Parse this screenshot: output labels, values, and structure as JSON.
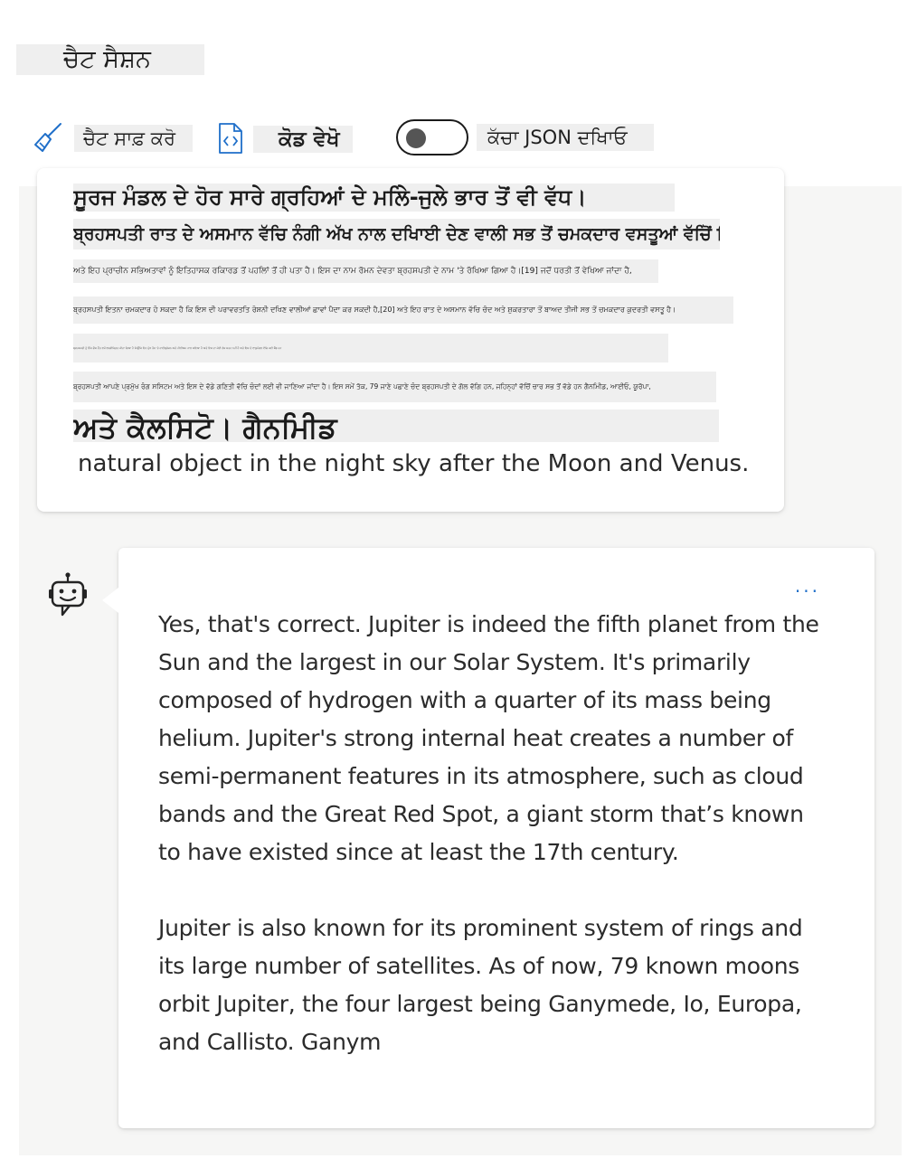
{
  "session": {
    "title": "ਚੈਟ ਸੈਸ਼ਨ"
  },
  "toolbar": {
    "clear_label": "ਚੈਟ ਸਾਫ਼ ਕਰੋ",
    "code_label": "ਕੋਡ ਵੇਖੋ",
    "json_label": "ਕੱਚਾ JSON ਦਖਿਾਓ",
    "json_toggle_on": false
  },
  "user_message": {
    "lines": [
      "ਸੂਰਜ ਮੰਡਲ ਦੇ ਹੋਰ ਸਾਰੇ ਗ੍ਰਹਿਆਂ ਦੇ ਮਲਿੇ-ਜੁਲੇ ਭਾਰ ਤੋਂ ਵੀ ਵੱਧ।",
      "ਬ੍ਰਹਸਪਤੀ ਰਾਤ ਦੇ ਅਸਮਾਨ ਵੱਚਿ ਨੰਗੀ ਅੱਖ ਨਾਲ ਦਖਿਾਈ ਦੇਣ ਵਾਲੀ ਸਭ ਤੋਂ ਚਮਕਦਾਰ ਵਸਤੂਆਂ ਵੱਚਿੋਂ ਇੱਕ ਹੈ,",
      "ਅਤੇ ਇਹ ਪ੍ਰਾਚੀਨ ਸਭਿਅਤਾਵਾਂ ਨੂੰ ਇਤਿਹਾਸਕ ਰਕਿਾਰਡ ਤੋਂ ਪਹਲਿਾਂ ਤੋਂ ਹੀ ਪਤਾ ਹੈ। ਇਸ ਦਾ ਨਾਮ ਰੋਮਨ ਦੇਵਤਾ ਬ੍ਰਹਸਪਤੀ ਦੇ ਨਾਮ 'ਤੇ ਰੱਖਿਆ ਗਿਆ ਹੈ।[19] ਜਦੋਂ ਧਰਤੀ ਤੋਂ ਵੇਖਿਆ ਜਾਂਦਾ ਹੈ,",
      "ਬ੍ਰਹਸਪਤੀ ਇਤਨਾ ਚਮਕਦਾਰ ਹੋ ਸਕਦਾ ਹੈ ਕਿ ਇਸ ਦੀ ਪਰਾਵਰਤਤਿ ਰੋਸ਼ਨੀ ਦਖਿਣ ਵਾਲੀਆਂ ਛਾਵਾਂ ਪੈਦਾ ਕਰ ਸਕਦੀ ਹੈ,[20] ਅਤੇ ਇਹ ਰਾਤ ਦੇ ਅਸਮਾਨ ਵੱਚਿ ਚੰਦ ਅਤੇ ਸ਼ੁਕਰਤਾਰਾ ਤੋਂ ਬਾਅਦ ਤੀਜੀ ਸਭ ਤੋਂ ਚਮਕਦਾਰ ਕੁਦਰਤੀ ਵਸਤੂ ਹੈ।",
      "ਬ੍ਰਹਸਪਤੀ ਨੂੰ ਇੱਕ ਗੈਸ ਦੈਂਤ ਵਜੋਂ ਵਰਗੀਕ੍ਰਿਤ ਕੀਤਾ ਗਿਆ ਹੈ ਕਿਉਂਕਿ ਇਹ ਮੁੱਖ ਤੌਰ 'ਤੇ ਹਾਈਡ੍ਰੋਜਨ ਅਤੇ ਹੀਲੀਅਮ ਨਾਲ ਬਣਿਆ ਹੈ ਅਤੇ ਇਸ ਦਾ ਕੋਈ ਠੋਸ ਸਤਹ ਨਹੀਂ ਹੈ ਅਤੇ ਇਸ ਦੇ ਵਾਯੂਮੰਡਲ ਵੱਚਿ ਕਈ ਬੈਂਡ ਹਨ",
      "ਬ੍ਰਹਸਪਤੀ ਆਪਣੇ ਪ੍ਰਮੁੱਖ ਰੰਗ ਸਸਿਟਮ ਅਤੇ ਇਸ ਦੇ ਵੱਡੇ ਗਣਿਤੀ ਵੱਚਿ ਚੰਦਾਂ ਲਈ ਵੀ ਜਾਣਿਆ ਜਾਂਦਾ ਹੈ। ਇਸ ਸਮੇਂ ਤੱਕ, 79 ਜਾਣੇ ਪਛਾਣੇ ਚੰਦ ਬ੍ਰਹਸਪਤੀ ਦੇ ਗੋਲ ਵੱਗਿ ਹਨ, ਜਹਿਨ੍ਹਾਂ ਵੱਚਿੋਂ ਚਾਰ ਸਭ ਤੋਂ ਵੱਡੇ ਹਨ ਗੈਨਮਿੀਡ, ਆਈਓ, ਯੂਰੋਪਾ,",
      "ਅਤੇ ਕੈਲਸਿਟੋ। ਗੈਨਮਿੀਡ"
    ],
    "english_tail": "natural object in the night sky after the Moon and Venus."
  },
  "bot_message": {
    "more_label": "...",
    "paragraphs": [
      "Yes, that's correct. Jupiter is indeed the fifth planet from the Sun and the largest in our Solar System. It's primarily composed of hydrogen with a quarter of its mass being helium. Jupiter's strong internal heat creates a number of semi-permanent features in its atmosphere, such as cloud bands and the Great Red Spot, a giant storm that’s known to have existed since at least the 17th century.",
      "Jupiter is also known for its prominent system of rings and its large number of satellites. As of now, 79 known moons orbit Jupiter, the four largest being Ganymede, Io, Europa, and Callisto. Ganym"
    ]
  },
  "icons": {
    "clear": "broom-icon",
    "code": "code-file-icon",
    "bot": "bot-avatar-icon"
  },
  "colors": {
    "link_accent": "#1f6fc9",
    "chat_background": "#f6f6f5",
    "label_background": "#efefef"
  }
}
